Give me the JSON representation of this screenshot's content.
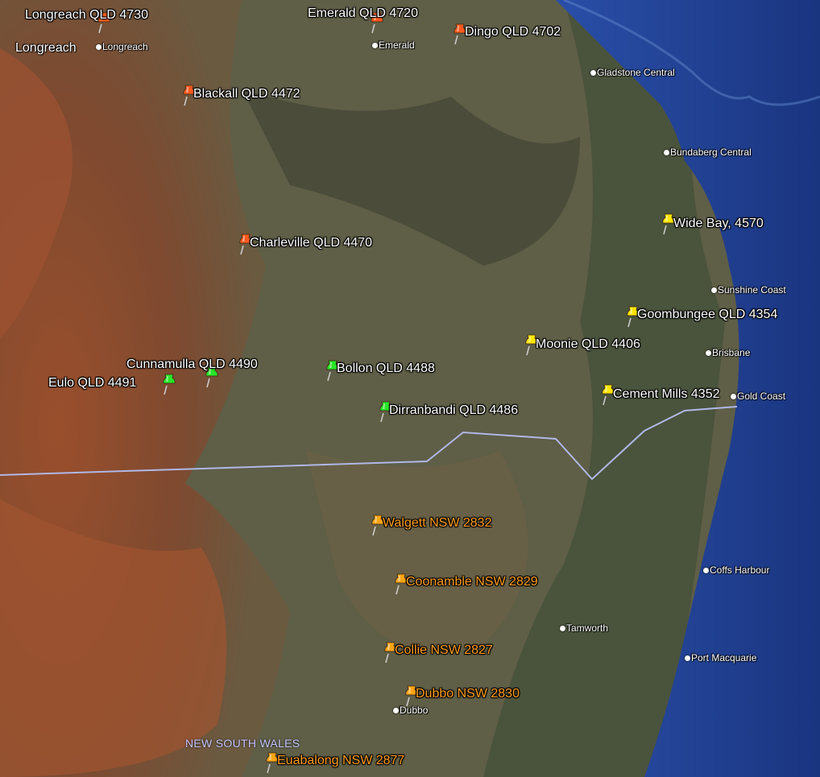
{
  "map": {
    "colors": {
      "ocean": "#1e3c8c",
      "land": "#5a5a44",
      "outback": "#8e4a2c",
      "border": "#b0b8e6"
    },
    "pins": [
      {
        "id": "longreach",
        "label": "Longreach QLD 4730",
        "color": "#ff5a1e",
        "label_color": "white"
      },
      {
        "id": "emerald",
        "label": "Emerald QLD 4720",
        "color": "#ff5a1e",
        "label_color": "white"
      },
      {
        "id": "dingo",
        "label": "Dingo QLD 4702",
        "color": "#ff5a1e",
        "label_color": "white"
      },
      {
        "id": "blackall",
        "label": "Blackall QLD 4472",
        "color": "#ff5a1e",
        "label_color": "white"
      },
      {
        "id": "charleville",
        "label": "Charleville QLD 4470",
        "color": "#ff5a1e",
        "label_color": "white"
      },
      {
        "id": "wide-bay",
        "label": "Wide Bay, 4570",
        "color": "#ffe600",
        "label_color": "white"
      },
      {
        "id": "goombungee",
        "label": "Goombungee QLD 4354",
        "color": "#ffe600",
        "label_color": "white"
      },
      {
        "id": "moonie",
        "label": "Moonie QLD 4406",
        "color": "#ffe600",
        "label_color": "white"
      },
      {
        "id": "cement-mills",
        "label": "Cement Mills 4352",
        "color": "#ffe600",
        "label_color": "white"
      },
      {
        "id": "cunnamulla",
        "label": "Cunnamulla QLD 4490",
        "color": "#28e628",
        "label_color": "white"
      },
      {
        "id": "eulo",
        "label": "Eulo QLD 4491",
        "color": "#28e628",
        "label_color": "white"
      },
      {
        "id": "bollon",
        "label": "Bollon QLD 4488",
        "color": "#28e628",
        "label_color": "white"
      },
      {
        "id": "dirranbandi",
        "label": "Dirranbandi QLD 4486",
        "color": "#28e628",
        "label_color": "white"
      },
      {
        "id": "walgett",
        "label": "Walgett NSW 2832",
        "color": "#ffa514",
        "label_color": "orange"
      },
      {
        "id": "coonamble",
        "label": "Coonamble NSW 2829",
        "color": "#ffa514",
        "label_color": "orange"
      },
      {
        "id": "collie",
        "label": "Collie NSW 2827",
        "color": "#ffa514",
        "label_color": "orange"
      },
      {
        "id": "dubbo",
        "label": "Dubbo NSW 2830",
        "color": "#ffa514",
        "label_color": "orange"
      },
      {
        "id": "euabalong",
        "label": "Euabalong NSW 2877",
        "color": "#ffa514",
        "label_color": "orange"
      }
    ],
    "towns": [
      {
        "id": "longreach-town",
        "label": "Longreach"
      },
      {
        "id": "emerald-town",
        "label": "Emerald"
      },
      {
        "id": "gladstone",
        "label": "Gladstone Central"
      },
      {
        "id": "bundaberg",
        "label": "Bundaberg Central"
      },
      {
        "id": "sunshine-coast",
        "label": "Sunshine Coast"
      },
      {
        "id": "brisbane",
        "label": "Brisbane"
      },
      {
        "id": "gold-coast",
        "label": "Gold Coast"
      },
      {
        "id": "coffs-harbour",
        "label": "Coffs Harbour"
      },
      {
        "id": "tamworth",
        "label": "Tamworth"
      },
      {
        "id": "port-macquarie",
        "label": "Port Macquarie"
      },
      {
        "id": "dubbo-town",
        "label": "Dubbo"
      }
    ],
    "place_label": "Longreach",
    "state_label": "NEW SOUTH WALES"
  }
}
